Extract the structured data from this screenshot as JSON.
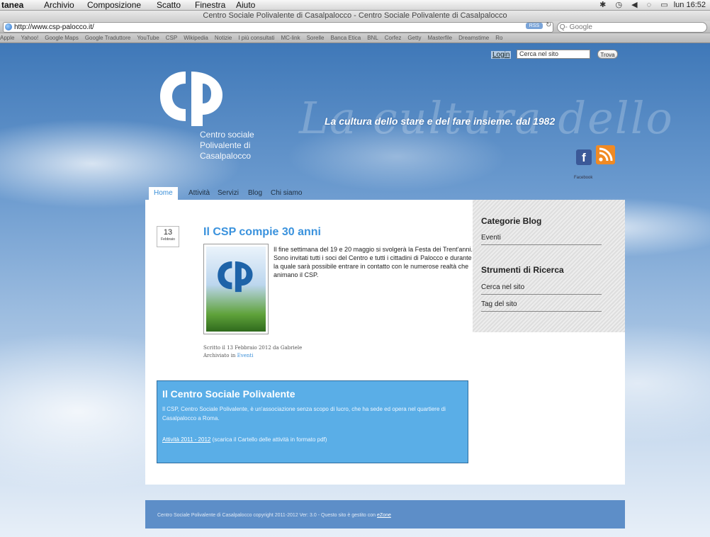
{
  "menubar": {
    "items": [
      "tanea",
      "Archivio",
      "Composizione",
      "Scatto",
      "Finestra",
      "Aiuto"
    ],
    "clock": "lun 16:52"
  },
  "window": {
    "title": "Centro Sociale Polivalente di Casalpalocco - Centro Sociale Polivalente di Casalpalocco"
  },
  "addressbar": {
    "url": "http://www.csp-palocco.it/",
    "search_placeholder": "Q- Google"
  },
  "bookmarks": [
    "Apple",
    "Yahoo!",
    "Google Maps",
    "Google Traduttore",
    "YouTube",
    "CSP",
    "Wikipedia",
    "Notizie",
    "I più consultati",
    "MC-link",
    "Sorelle",
    "Banca Etica",
    "BNL",
    "Corfez",
    "Getty",
    "Masterfile",
    "Dreamstime",
    "Ro"
  ],
  "site": {
    "login": "Login",
    "search_value": "Cerca nel sito",
    "search_button": "Trova",
    "logo_lines": [
      "Centro sociale",
      "Polivalente di",
      "Casalpalocco"
    ],
    "script_text": "La cultura dello",
    "tagline": "La cultura dello stare e del fare insieme. dal 1982",
    "facebook_label": "Facebook",
    "nav": [
      "Home",
      "Attività",
      "Servizi",
      "Blog",
      "Chi siamo"
    ]
  },
  "post": {
    "day": "13",
    "month": "Febbraio",
    "title": "Il CSP compie 30 anni",
    "body": "Il fine settimana del 19 e 20 maggio si svolgerà la Festa dei Trent'anni. Sono invitati tutti i soci del Centro e tutti i cittadini di Palocco e durante la quale sarà possibile entrare in contatto con le numerose realtà che animano il CSP.",
    "meta_written": "Scritto il 13 Febbraio 2012 da Gabriele",
    "meta_archived_prefix": "Archiviato in",
    "meta_category": "Eventi"
  },
  "sidebar": {
    "heading1": "Categorie Blog",
    "link1": "Eventi",
    "heading2": "Strumenti di Ricerca",
    "link2": "Cerca nel sito",
    "link3": "Tag del sito"
  },
  "about": {
    "title": "Il Centro Sociale Polivalente",
    "text": "Il CSP, Centro Sociale Polivalente, è un'associazione senza scopo di lucro, che ha sede ed opera nel quartiere di Casalpalocco a Roma.",
    "download_link": "Attività 2011 - 2012",
    "download_note": "(scarica il Cartello delle attività in formato pdf)"
  },
  "footer": {
    "text": "Centro Sociale Polivalente di Casalpalocco copyright 2011-2012 Ver: 3.0 - Questo sito è gestito con",
    "link": "eZone"
  },
  "colors": {
    "accent": "#3a92dd",
    "box": "#5aaee7",
    "footer": "#5d8ec8"
  }
}
